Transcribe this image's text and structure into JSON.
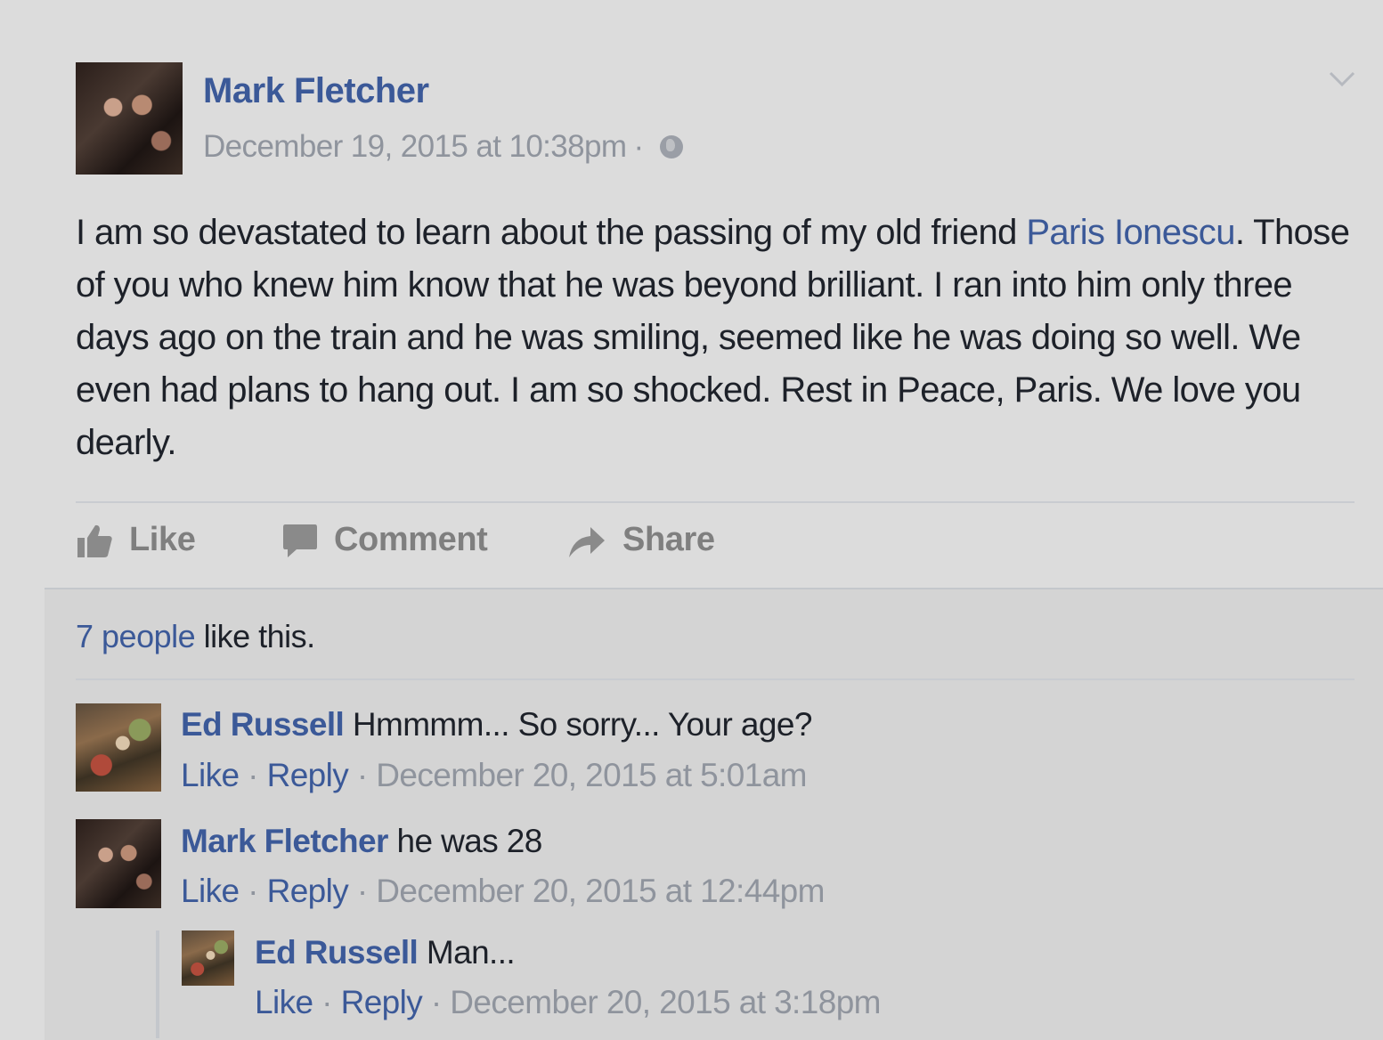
{
  "post": {
    "author": "Mark Fletcher",
    "timestamp": "December 19, 2015 at 10:38pm",
    "separator": "·",
    "privacy_icon": "globe-icon",
    "menu_icon": "chevron-down-icon",
    "body": {
      "line1_before": "I am so devastated to learn about the passing of my old friend ",
      "mention": "Paris Ionescu",
      "line1_after": ".",
      "rest": "Those of you who knew him know that he was beyond brilliant. I ran into him only three days ago on the train and he was smiling, seemed like he was doing so well. We even had plans to hang out. I am so shocked. Rest in Peace, Paris. We love you dearly."
    }
  },
  "actions": {
    "like": "Like",
    "comment": "Comment",
    "share": "Share"
  },
  "likes_summary": {
    "count_link": "7 people",
    "suffix": " like this."
  },
  "comments": [
    {
      "author": "Ed Russell",
      "text": " Hmmmm... So sorry... Your age?",
      "like": "Like",
      "reply": "Reply",
      "timestamp": "December 20, 2015 at 5:01am"
    },
    {
      "author": "Mark Fletcher",
      "text": " he was 28",
      "like": "Like",
      "reply": "Reply",
      "timestamp": "December 20, 2015 at 12:44pm"
    }
  ],
  "reply": {
    "author": "Ed Russell",
    "text": " Man...",
    "like": "Like",
    "reply": "Reply",
    "timestamp": "December 20, 2015 at 3:18pm"
  },
  "colors": {
    "link": "#3b5998",
    "meta": "#8f949d",
    "background": "#dcdcdc"
  }
}
